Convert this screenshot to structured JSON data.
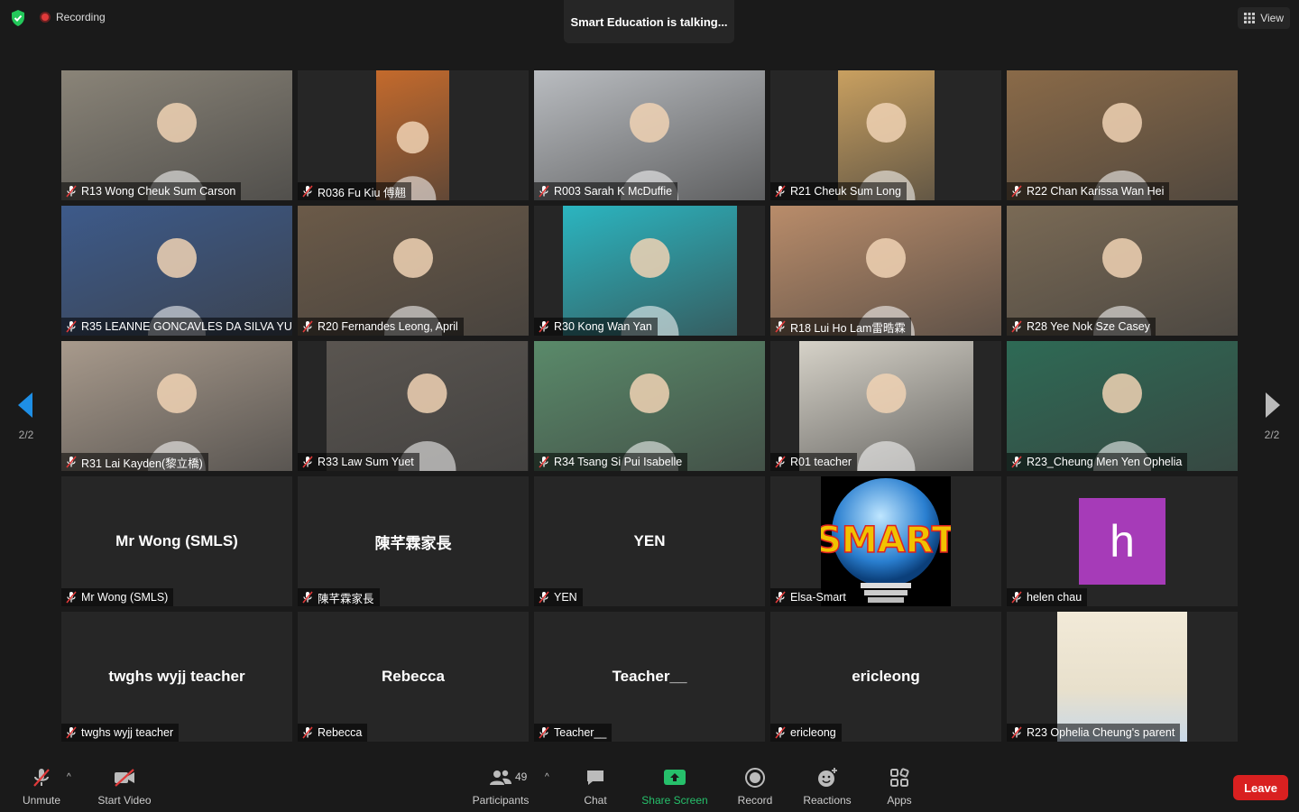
{
  "top_bar": {
    "recording_label": "Recording",
    "talking_banner": "Smart Education is talking...",
    "view_label": "View"
  },
  "pagination": {
    "left": "2/2",
    "right": "2/2"
  },
  "participants": [
    {
      "label": "R13 Wong Cheuk Sum Carson",
      "kind": "video",
      "bg": "#8a8478"
    },
    {
      "label": "R036 Fu Kiu 傅翹",
      "kind": "video",
      "bg": "#c46a2c"
    },
    {
      "label": "R003 Sarah K McDuffie",
      "kind": "video",
      "bg": "#b9bcc0"
    },
    {
      "label": "R21 Cheuk Sum Long",
      "kind": "video",
      "bg": "#c9a060"
    },
    {
      "label": "R22 Chan Karissa Wan Hei",
      "kind": "video",
      "bg": "#8a6a48"
    },
    {
      "label": "R35 LEANNE GONCAVLES DA SILVA YU",
      "kind": "video",
      "bg": "#3d5a8a"
    },
    {
      "label": "R20 Fernandes Leong, April",
      "kind": "video",
      "bg": "#6b5a48"
    },
    {
      "label": "R30 Kong Wan Yan",
      "kind": "video",
      "bg": "#2bb5c0"
    },
    {
      "label": "R18 Lui Ho Lam雷晧霖",
      "kind": "video",
      "bg": "#b98c6a"
    },
    {
      "label": "R28 Yee Nok Sze Casey",
      "kind": "video",
      "bg": "#7a6a55"
    },
    {
      "label": "R31 Lai Kayden(黎立橋)",
      "kind": "video",
      "bg": "#a89a8c"
    },
    {
      "label": "R33 Law Sum Yuet",
      "kind": "video",
      "bg": "#5a5550"
    },
    {
      "label": "R34 Tsang Si Pui Isabelle",
      "kind": "video",
      "bg": "#5a8a6a"
    },
    {
      "label": "R01 teacher",
      "kind": "video",
      "bg": "#d6d2c8"
    },
    {
      "label": "R23_Cheung Men Yen Ophelia",
      "kind": "video",
      "bg": "#2e6a55"
    },
    {
      "label": "Mr Wong (SMLS)",
      "kind": "name",
      "display": "Mr Wong (SMLS)"
    },
    {
      "label": "陳芊霖家長",
      "kind": "name",
      "display": "陳芊霖家長"
    },
    {
      "label": "YEN",
      "kind": "name",
      "display": "YEN"
    },
    {
      "label": "Elsa-Smart",
      "kind": "logo",
      "logo_text": "SMART"
    },
    {
      "label": "helen chau",
      "kind": "avatar",
      "avatar_letter": "h"
    },
    {
      "label": "twghs wyjj teacher",
      "kind": "name",
      "display": "twghs wyjj teacher"
    },
    {
      "label": "Rebecca",
      "kind": "name",
      "display": "Rebecca"
    },
    {
      "label": "Teacher__",
      "kind": "name",
      "display": "Teacher__"
    },
    {
      "label": "ericleong",
      "kind": "name",
      "display": "ericleong"
    },
    {
      "label": "R23 Ophelia Cheung's parent",
      "kind": "image",
      "bg": "#e8e0cc"
    }
  ],
  "toolbar": {
    "unmute": "Unmute",
    "start_video": "Start Video",
    "participants": "Participants",
    "participants_count": "49",
    "chat": "Chat",
    "share_screen": "Share Screen",
    "record": "Record",
    "reactions": "Reactions",
    "apps": "Apps",
    "leave": "Leave"
  },
  "colors": {
    "background": "#1a1a1a",
    "tile": "#262626",
    "share_green": "#26c06b",
    "leave_red": "#d92020",
    "mute_red": "#e03a3a"
  }
}
